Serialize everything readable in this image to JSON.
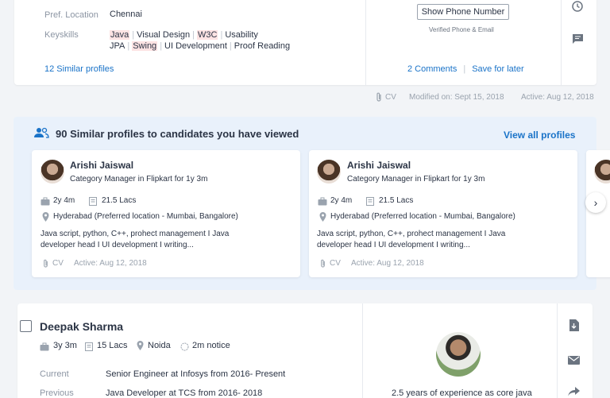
{
  "top_card": {
    "pref_location_label": "Pref. Location",
    "pref_location_value": "Chennai",
    "keyskills_label": "Keyskills",
    "skills_line1": [
      {
        "text": "Java",
        "highlight": true
      },
      {
        "text": "Visual Design",
        "highlight": false
      },
      {
        "text": "W3C",
        "highlight": true
      },
      {
        "text": "Usability",
        "highlight": false
      }
    ],
    "skills_line2": [
      {
        "text": "JPA",
        "highlight": false
      },
      {
        "text": "Swing",
        "highlight": true
      },
      {
        "text": "UI Development",
        "highlight": false
      },
      {
        "text": "Proof Reading",
        "highlight": false
      }
    ],
    "skill_separator": "|",
    "similar_profiles_link": "12 Similar profiles",
    "show_phone_button": "Show Phone Number",
    "verified_text": "Verified Phone & Email",
    "comments_link": "2 Comments",
    "link_separator": "|",
    "save_later_link": "Save for later",
    "icons": [
      "clock-icon",
      "chat-icon"
    ]
  },
  "top_meta": {
    "cv_label": "CV",
    "modified": "Modified on: Sept 15, 2018",
    "active": "Active: Aug 12, 2018"
  },
  "similar": {
    "title": "90 Similar profiles to candidates you have viewed",
    "view_all": "View all profiles",
    "cards": [
      {
        "name": "Arishi Jaiswal",
        "role": "Category Manager in Flipkart for 1y 3m",
        "experience": "2y 4m",
        "salary": "21.5 Lacs",
        "location": "Hyderabad (Preferred location - Mumbai, Bangalore)",
        "skills_line1": "Java script, python, C++, prohect management  I  Java",
        "skills_line2": "developer head  I UI development  I  writing...",
        "cv": "CV",
        "active": "Active: Aug 12, 2018"
      },
      {
        "name": "Arishi Jaiswal",
        "role": "Category Manager in Flipkart for 1y 3m",
        "experience": "2y 4m",
        "salary": "21.5 Lacs",
        "location": "Hyderabad (Preferred location - Mumbai, Bangalore)",
        "skills_line1": "Java script, python, C++, prohect management  I  Java",
        "skills_line2": "developer head  I UI development  I  writing...",
        "cv": "CV",
        "active": "Active: Aug 12, 2018"
      }
    ],
    "next_icon": "›"
  },
  "candidate": {
    "name": "Deepak Sharma",
    "experience": "3y 3m",
    "salary": "15 Lacs",
    "location": "Noida",
    "notice": "2m notice",
    "current_label": "Current",
    "current_value": "Senior Engineer at Infosys from 2016- Present",
    "previous_label": "Previous",
    "previous_value": "Java Developer at TCS from 2016- 2018",
    "summary": "2.5 years of experience as core java",
    "actions": [
      "download-icon",
      "mail-icon",
      "share-icon"
    ]
  },
  "colors": {
    "accent": "#1a73c8",
    "panel_bg": "#e9f1fb",
    "highlight": "#fde3e3"
  }
}
